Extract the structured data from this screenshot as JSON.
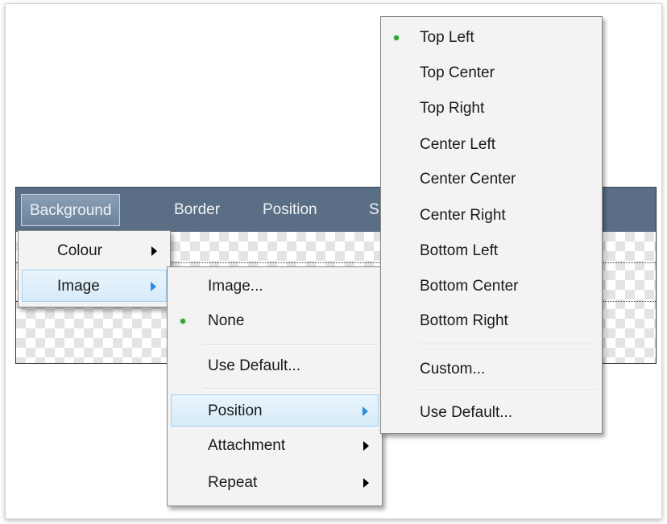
{
  "menubar": {
    "items": [
      "Background",
      "Border",
      "Position",
      "S"
    ]
  },
  "background_menu": {
    "items": [
      {
        "label": "Colour",
        "has_submenu": true,
        "highlighted": false
      },
      {
        "label": "Image",
        "has_submenu": true,
        "highlighted": true
      }
    ]
  },
  "image_menu": {
    "items": [
      {
        "label": "Image...",
        "checked": false,
        "has_submenu": false,
        "highlighted": false
      },
      {
        "label": "None",
        "checked": true,
        "has_submenu": false,
        "highlighted": false
      },
      {
        "label": "Use Default...",
        "checked": false,
        "has_submenu": false,
        "highlighted": false
      },
      {
        "label": "Position",
        "checked": false,
        "has_submenu": true,
        "highlighted": true
      },
      {
        "label": "Attachment",
        "checked": false,
        "has_submenu": true,
        "highlighted": false
      },
      {
        "label": "Repeat",
        "checked": false,
        "has_submenu": true,
        "highlighted": false
      }
    ]
  },
  "position_menu": {
    "items": [
      {
        "label": "Top Left",
        "checked": true
      },
      {
        "label": "Top Center",
        "checked": false
      },
      {
        "label": "Top Right",
        "checked": false
      },
      {
        "label": "Center Left",
        "checked": false
      },
      {
        "label": "Center Center",
        "checked": false
      },
      {
        "label": "Center Right",
        "checked": false
      },
      {
        "label": "Bottom Left",
        "checked": false
      },
      {
        "label": "Bottom Center",
        "checked": false
      },
      {
        "label": "Bottom Right",
        "checked": false
      },
      {
        "label": "Custom...",
        "checked": false
      },
      {
        "label": "Use Default...",
        "checked": false
      }
    ]
  },
  "colors": {
    "menubar": "#5a6f85",
    "highlight": "#d7ebf9",
    "check_bullet": "#31a12f",
    "submenu_arrow_active": "#2a8ee0"
  }
}
